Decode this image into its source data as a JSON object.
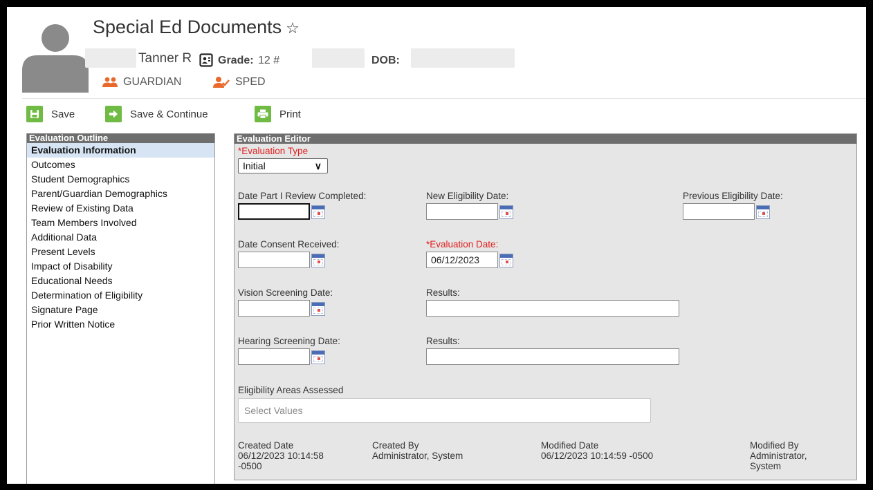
{
  "header": {
    "title": "Special Ed Documents",
    "student_name": "Tanner R",
    "grade_label": "Grade:",
    "grade_value": "12 #",
    "dob_label": "DOB:",
    "flags": [
      {
        "label": "GUARDIAN",
        "icon": "users-icon"
      },
      {
        "label": "SPED",
        "icon": "user-check-icon"
      }
    ],
    "accent_color": "#e8692b"
  },
  "toolbar": {
    "save_label": "Save",
    "save_continue_label": "Save & Continue",
    "print_label": "Print",
    "button_color": "#6fbb44"
  },
  "outline": {
    "title": "Evaluation Outline",
    "items": [
      {
        "label": "Evaluation Information",
        "active": true
      },
      {
        "label": "Outcomes"
      },
      {
        "label": "Student Demographics"
      },
      {
        "label": "Parent/Guardian Demographics"
      },
      {
        "label": "Review of Existing Data"
      },
      {
        "label": "Team Members Involved"
      },
      {
        "label": "Additional Data"
      },
      {
        "label": "Present Levels"
      },
      {
        "label": "Impact of Disability"
      },
      {
        "label": "Educational Needs"
      },
      {
        "label": "Determination of Eligibility"
      },
      {
        "label": "Signature Page"
      },
      {
        "label": "Prior Written Notice"
      }
    ]
  },
  "editor": {
    "title": "Evaluation Editor",
    "evaluation_type_label": "*Evaluation Type",
    "evaluation_type_value": "Initial",
    "date_part1_label": "Date Part I Review Completed:",
    "date_part1_value": "",
    "new_eligibility_label": "New Eligibility Date:",
    "new_eligibility_value": "",
    "prev_eligibility_label": "Previous Eligibility Date:",
    "prev_eligibility_value": "",
    "consent_label": "Date Consent Received:",
    "consent_value": "",
    "evaluation_date_label": "*Evaluation Date:",
    "evaluation_date_value": "06/12/2023",
    "vision_label": "Vision Screening Date:",
    "vision_value": "",
    "vision_results_label": "Results:",
    "vision_results_value": "",
    "hearing_label": "Hearing Screening Date:",
    "hearing_value": "",
    "hearing_results_label": "Results:",
    "hearing_results_value": "",
    "eligibility_areas_label": "Eligibility Areas Assessed",
    "eligibility_areas_placeholder": "Select Values",
    "created_date_label": "Created Date",
    "created_date_value": "06/12/2023 10:14:58 -0500",
    "created_by_label": "Created By",
    "created_by_value": "Administrator, System",
    "modified_date_label": "Modified Date",
    "modified_date_value": "06/12/2023 10:14:59 -0500",
    "modified_by_label": "Modified By",
    "modified_by_value": "Administrator, System"
  }
}
